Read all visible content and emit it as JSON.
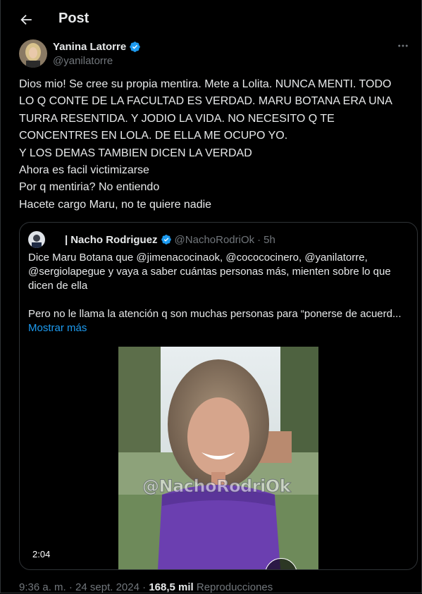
{
  "header": {
    "title": "Post",
    "back_icon": "arrow-left-icon"
  },
  "post": {
    "author": {
      "name": "Yanina Latorre",
      "handle": "@yanilatorre",
      "verified": true
    },
    "more_icon": "more-horizontal-icon",
    "lines": [
      "Dios mio! Se cree su propia mentira. Mete a Lolita. NUNCA MENTI. TODO",
      "LO Q CONTE DE LA FACULTAD ES VERDAD. MARU BOTANA ERA UNA",
      "TURRA RESENTIDA. Y JODIO LA VIDA. NO NECESITO Q TE",
      "CONCENTRES EN LOLA. DE ELLA ME OCUPO YO.",
      "Y LOS DEMAS TAMBIEN DICEN LA VERDAD",
      "Ahora es facil victimizarse",
      "Por q mentiria? No entiendo",
      "Hacete cargo Maru, no te quiere nadie"
    ]
  },
  "quote": {
    "pipe": "|",
    "name": "Nacho Rodriguez",
    "handle": "@NachoRodriOk",
    "dot": "·",
    "time": "5h",
    "lines": [
      "Dice Maru Botana que @jimenacocinaok, @cocococinero, @yanilatorre,",
      "@sergiolapegue y vaya a saber cuántas personas más, mienten sobre lo que",
      "dicen de ella"
    ],
    "line2": "Pero no le llama la atención q son muchas personas para “ponerse de acuerd...",
    "show_more": "Mostrar más",
    "video": {
      "duration": "2:04",
      "watermark": "@NachoRodriOk"
    }
  },
  "meta": {
    "time": "9:36 a. m.",
    "dot": "·",
    "date": "24 sept. 2024",
    "views": "168,5 mil",
    "views_label": "Reproducciones"
  },
  "colors": {
    "background": "#000000",
    "text": "#e7e9ea",
    "muted": "#71767b",
    "accent": "#1d9bf0",
    "border": "#2f3336"
  }
}
